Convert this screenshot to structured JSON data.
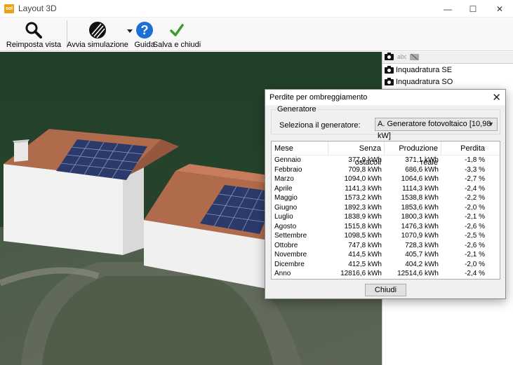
{
  "window": {
    "app_icon_text": "sol",
    "title": "Layout 3D",
    "minimize": "—",
    "maximize": "☐",
    "close": "✕"
  },
  "toolbar": {
    "reset_view": "Reimposta vista",
    "start_simulation": "Avvia simulazione",
    "guide": "Guida",
    "save_close": "Salva e chiudi"
  },
  "right_panel": {
    "cameras": [
      {
        "label": "Inquadratura SE"
      },
      {
        "label": "Inquadratura SO"
      }
    ]
  },
  "dialog": {
    "title": "Perdite per ombreggiamento",
    "group_label": "Generatore",
    "select_label": "Seleziona il generatore:",
    "selected_generator": "A. Generatore fotovoltaico [10,98 kW]",
    "columns": [
      "Mese",
      "Senza ostacoli",
      "Produzione reale",
      "Perdita"
    ],
    "rows": [
      [
        "Gennaio",
        "377,9 kWh",
        "371,1 kWh",
        "-1,8 %"
      ],
      [
        "Febbraio",
        "709,8 kWh",
        "686,6 kWh",
        "-3,3 %"
      ],
      [
        "Marzo",
        "1094,0 kWh",
        "1064,6 kWh",
        "-2,7 %"
      ],
      [
        "Aprile",
        "1141,3 kWh",
        "1114,3 kWh",
        "-2,4 %"
      ],
      [
        "Maggio",
        "1573,2 kWh",
        "1538,8 kWh",
        "-2,2 %"
      ],
      [
        "Giugno",
        "1892,3 kWh",
        "1853,6 kWh",
        "-2,0 %"
      ],
      [
        "Luglio",
        "1838,9 kWh",
        "1800,3 kWh",
        "-2,1 %"
      ],
      [
        "Agosto",
        "1515,8 kWh",
        "1476,3 kWh",
        "-2,6 %"
      ],
      [
        "Settembre",
        "1098,5 kWh",
        "1070,9 kWh",
        "-2,5 %"
      ],
      [
        "Ottobre",
        "747,8 kWh",
        "728,3 kWh",
        "-2,6 %"
      ],
      [
        "Novembre",
        "414,5 kWh",
        "405,7 kWh",
        "-2,1 %"
      ],
      [
        "Dicembre",
        "412,5 kWh",
        "404,2 kWh",
        "-2,0 %"
      ],
      [
        "Anno",
        "12816,6 kWh",
        "12514,6 kWh",
        "-2,4 %"
      ]
    ],
    "close_button": "Chiudi"
  }
}
